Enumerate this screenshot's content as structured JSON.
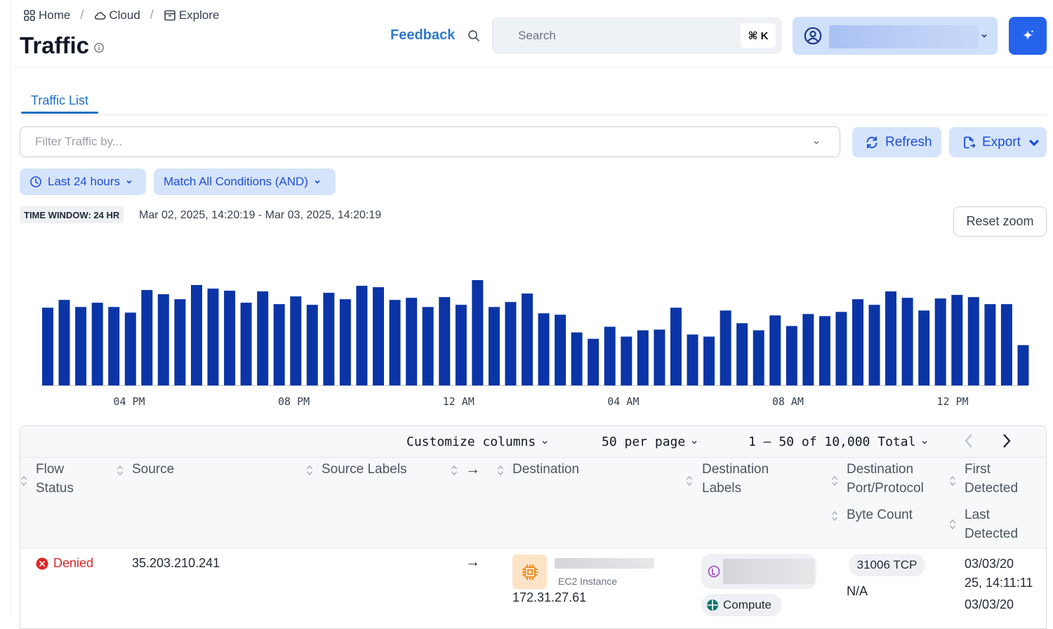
{
  "breadcrumb": [
    {
      "label": "Home",
      "icon": "grid-icon"
    },
    {
      "label": "Cloud",
      "icon": "cloud-icon"
    },
    {
      "label": "Explore",
      "icon": "archive-icon"
    }
  ],
  "page": {
    "title": "Traffic"
  },
  "header": {
    "feedback_label": "Feedback",
    "search_placeholder": "Search",
    "search_shortcut": "⌘ K"
  },
  "tabs": [
    {
      "label": "Traffic List",
      "active": true
    }
  ],
  "filter": {
    "placeholder": "Filter Traffic by...",
    "refresh_label": "Refresh",
    "export_label": "Export",
    "time_range_label": "Last 24 hours",
    "match_label": "Match All Conditions (AND)"
  },
  "time_window": {
    "badge": "TIME WINDOW: 24 HR",
    "range": "Mar 02, 2025, 14:20:19 - Mar 03, 2025, 14:20:19",
    "reset_zoom_label": "Reset zoom"
  },
  "chart_data": {
    "type": "bar",
    "tick_labels": [
      "04 PM",
      "08 PM",
      "12 AM",
      "04 AM",
      "08 AM",
      "12 PM"
    ],
    "values": [
      110,
      121,
      111,
      117,
      111,
      103,
      135,
      129,
      122,
      142,
      137,
      134,
      117,
      133,
      115,
      126,
      114,
      131,
      122,
      141,
      139,
      121,
      124,
      111,
      125,
      114,
      149,
      111,
      118,
      130,
      102,
      100,
      75,
      66,
      83,
      69,
      78,
      79,
      110,
      72,
      69,
      106,
      88,
      78,
      99,
      84,
      101,
      98,
      104,
      122,
      114,
      133,
      124,
      106,
      123,
      128,
      125,
      115,
      115,
      57
    ],
    "color": "#0b35a6",
    "grid": false,
    "legend": "none"
  },
  "table": {
    "toolbar": {
      "customize_label": "Customize columns",
      "per_page_label": "50 per page",
      "pagination_label": "1 – 50 of 10,000 Total"
    },
    "headers": {
      "flow_status": [
        "Flow",
        "Status"
      ],
      "source": "Source",
      "source_labels": "Source Labels",
      "arrow": "→",
      "destination": "Destination",
      "destination_labels": [
        "Destination",
        "Labels"
      ],
      "port_protocol": [
        "Destination",
        "Port/Protocol"
      ],
      "byte_count": "Byte Count",
      "first_detected": [
        "First",
        "Detected"
      ],
      "last_detected": [
        "Last",
        "Detected"
      ]
    },
    "rows": [
      {
        "status": "Denied",
        "source": "35.203.210.241",
        "arrow": "→",
        "destination_type": "EC2 Instance",
        "destination_ip": "172.31.27.61",
        "label_chip": "Compute",
        "port_protocol": "31006 TCP",
        "byte_count": "N/A",
        "first_detected": [
          "03/03/20",
          "25, 14:11:11"
        ],
        "last_detected": [
          "03/03/20"
        ]
      }
    ]
  },
  "colors": {
    "accent": "#1d6fc7",
    "bar": "#0b35a6",
    "denied": "#dc2626",
    "ec2": "#e8891c"
  }
}
